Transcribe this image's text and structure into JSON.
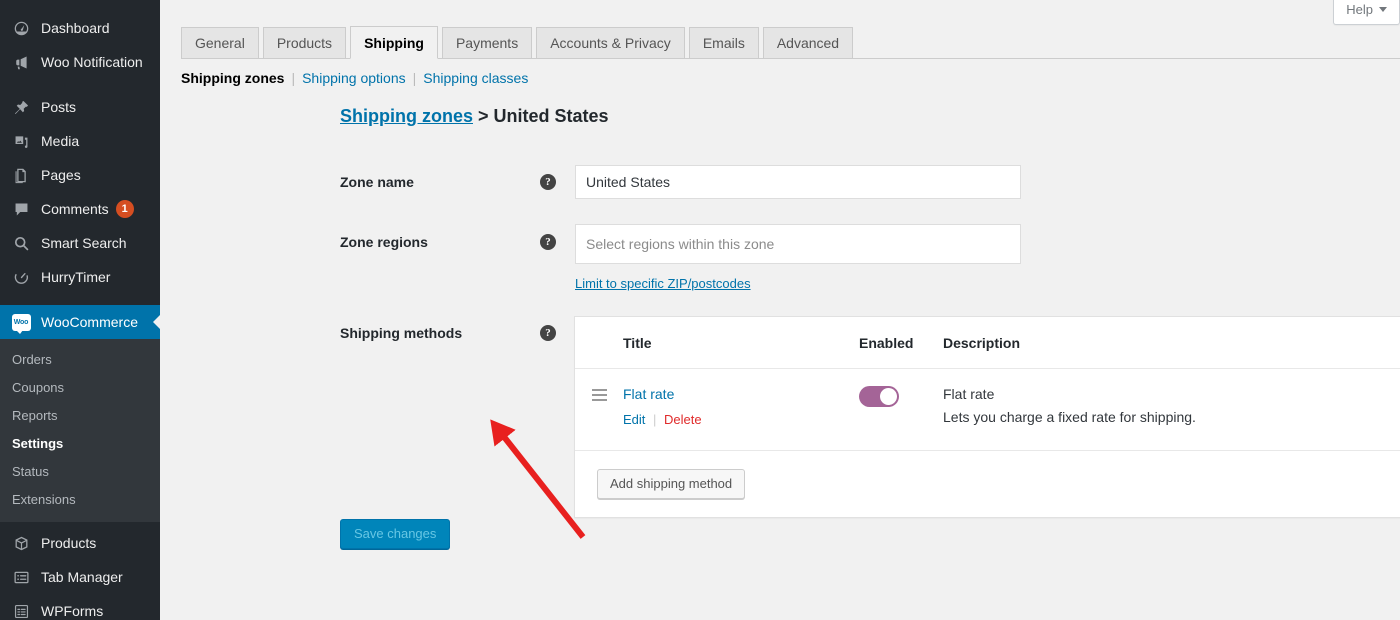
{
  "sidebar": {
    "items": [
      {
        "label": "Dashboard",
        "icon": "dashboard-icon",
        "active": false
      },
      {
        "label": "Woo Notification",
        "icon": "megaphone-icon",
        "active": false
      },
      {
        "label": "Posts",
        "icon": "pin-icon",
        "active": false
      },
      {
        "label": "Media",
        "icon": "media-icon",
        "active": false
      },
      {
        "label": "Pages",
        "icon": "pages-icon",
        "active": false
      },
      {
        "label": "Comments",
        "icon": "comment-icon",
        "active": false,
        "badge": "1"
      },
      {
        "label": "Smart Search",
        "icon": "search-icon",
        "active": false
      },
      {
        "label": "HurryTimer",
        "icon": "timer-icon",
        "active": false
      },
      {
        "label": "WooCommerce",
        "icon": "woocommerce-icon",
        "active": true
      },
      {
        "label": "Products",
        "icon": "products-icon",
        "active": false
      },
      {
        "label": "Tab Manager",
        "icon": "tab-manager-icon",
        "active": false
      },
      {
        "label": "WPForms",
        "icon": "wpforms-icon",
        "active": false
      }
    ],
    "woocommerce_badge_text": "Woo",
    "submenu": [
      {
        "label": "Orders",
        "current": false
      },
      {
        "label": "Coupons",
        "current": false
      },
      {
        "label": "Reports",
        "current": false
      },
      {
        "label": "Settings",
        "current": true
      },
      {
        "label": "Status",
        "current": false
      },
      {
        "label": "Extensions",
        "current": false
      }
    ]
  },
  "header": {
    "help_label": "Help"
  },
  "tabs": [
    {
      "label": "General",
      "active": false
    },
    {
      "label": "Products",
      "active": false
    },
    {
      "label": "Shipping",
      "active": true
    },
    {
      "label": "Payments",
      "active": false
    },
    {
      "label": "Accounts & Privacy",
      "active": false
    },
    {
      "label": "Emails",
      "active": false
    },
    {
      "label": "Advanced",
      "active": false
    }
  ],
  "subnav": {
    "current": "Shipping zones",
    "links": [
      "Shipping options",
      "Shipping classes"
    ],
    "separator": "|"
  },
  "breadcrumb": {
    "link": "Shipping zones",
    "separator": ">",
    "current": "United States"
  },
  "form": {
    "zone_name": {
      "label": "Zone name",
      "value": "United States",
      "help": "?"
    },
    "zone_regions": {
      "label": "Zone regions",
      "placeholder": "Select regions within this zone",
      "help": "?",
      "zip_link": "Limit to specific ZIP/postcodes"
    },
    "shipping_methods": {
      "label": "Shipping methods",
      "help": "?"
    }
  },
  "methods_table": {
    "columns": [
      "Title",
      "Enabled",
      "Description"
    ],
    "rows": [
      {
        "title": "Flat rate",
        "edit_label": "Edit",
        "action_separator": "|",
        "delete_label": "Delete",
        "enabled": true,
        "desc_title": "Flat rate",
        "desc_text": "Lets you charge a fixed rate for shipping."
      }
    ],
    "add_button": "Add shipping method"
  },
  "save_button": "Save changes",
  "colors": {
    "admin_bar": "#23282d",
    "submenu_bg": "#32373c",
    "accent_blue": "#0073aa",
    "link_blue": "#0085ba",
    "toggle_on": "#a46497",
    "delete_red": "#e02b2b",
    "badge_orange": "#d54e21",
    "page_bg": "#f1f1f1",
    "annotation_arrow": "#e8201f"
  }
}
